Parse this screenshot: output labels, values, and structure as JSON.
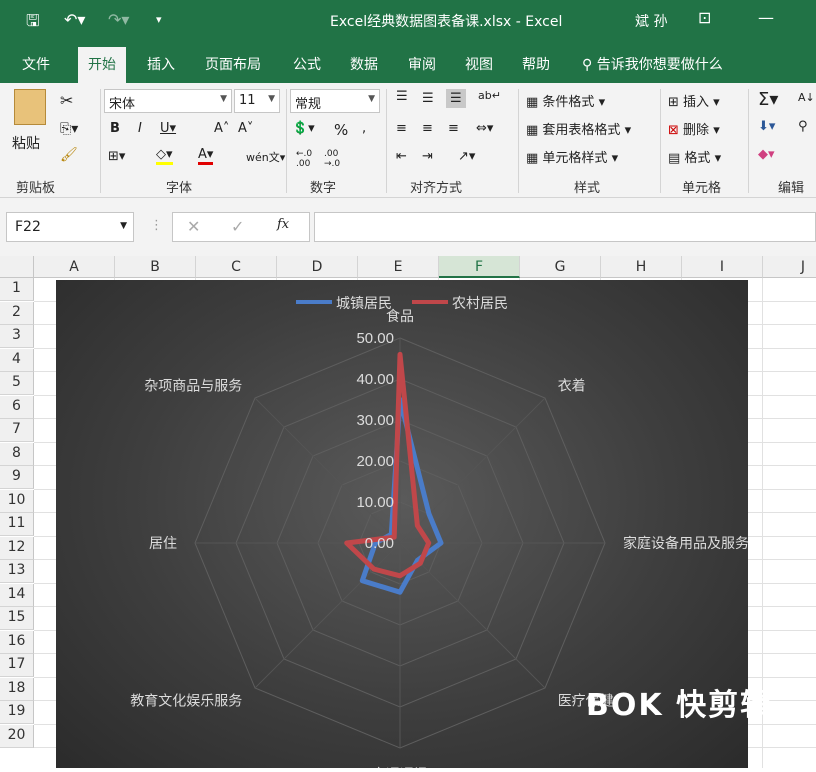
{
  "titlebar": {
    "filename": "Excel经典数据图表备课.xlsx",
    "app": "Excel",
    "user": "斌 孙"
  },
  "menu": [
    "文件",
    "开始",
    "插入",
    "页面布局",
    "公式",
    "数据",
    "审阅",
    "视图",
    "帮助"
  ],
  "tell_me": "告诉我你想要做什么",
  "ribbon": {
    "paste": "粘贴",
    "clipboard": "剪贴板",
    "font_name": "宋体",
    "font_size": "11",
    "font_group": "字体",
    "number_format": "常规",
    "number_group": "数字",
    "align_group": "对齐方式",
    "cond_format": "条件格式",
    "table_format": "套用表格格式",
    "cell_style": "单元格样式",
    "styles_group": "样式",
    "insert": "插入",
    "delete": "删除",
    "format": "格式",
    "cells_group": "单元格",
    "edit_group": "编辑"
  },
  "namebox": "F22",
  "formula": "",
  "columns": [
    "A",
    "B",
    "C",
    "D",
    "E",
    "F",
    "G",
    "H",
    "I",
    "J"
  ],
  "rows": [
    "1",
    "2",
    "3",
    "4",
    "5",
    "6",
    "7",
    "8",
    "9",
    "10",
    "11",
    "12",
    "13",
    "14",
    "15",
    "16",
    "17",
    "18",
    "19",
    "20"
  ],
  "selected_column": "F",
  "watermark": "快剪辑",
  "chart_data": {
    "type": "radar",
    "categories": [
      "食品",
      "衣着",
      "家庭设备用品及服务",
      "医疗保健",
      "交通通讯",
      "教育文化娱乐服务",
      "居住",
      "杂项商品与服务"
    ],
    "series": [
      {
        "name": "城镇居民",
        "color": "#4a7cc9",
        "values": [
          35,
          10,
          10,
          6,
          12,
          13,
          6,
          3
        ]
      },
      {
        "name": "农村居民",
        "color": "#c0474a",
        "values": [
          46,
          6,
          7,
          7,
          8,
          9,
          13,
          2
        ]
      }
    ],
    "radial_ticks": [
      "0.00",
      "10.00",
      "20.00",
      "30.00",
      "40.00",
      "50.00"
    ],
    "rmax": 50,
    "legend_position": "top",
    "grid": true
  }
}
